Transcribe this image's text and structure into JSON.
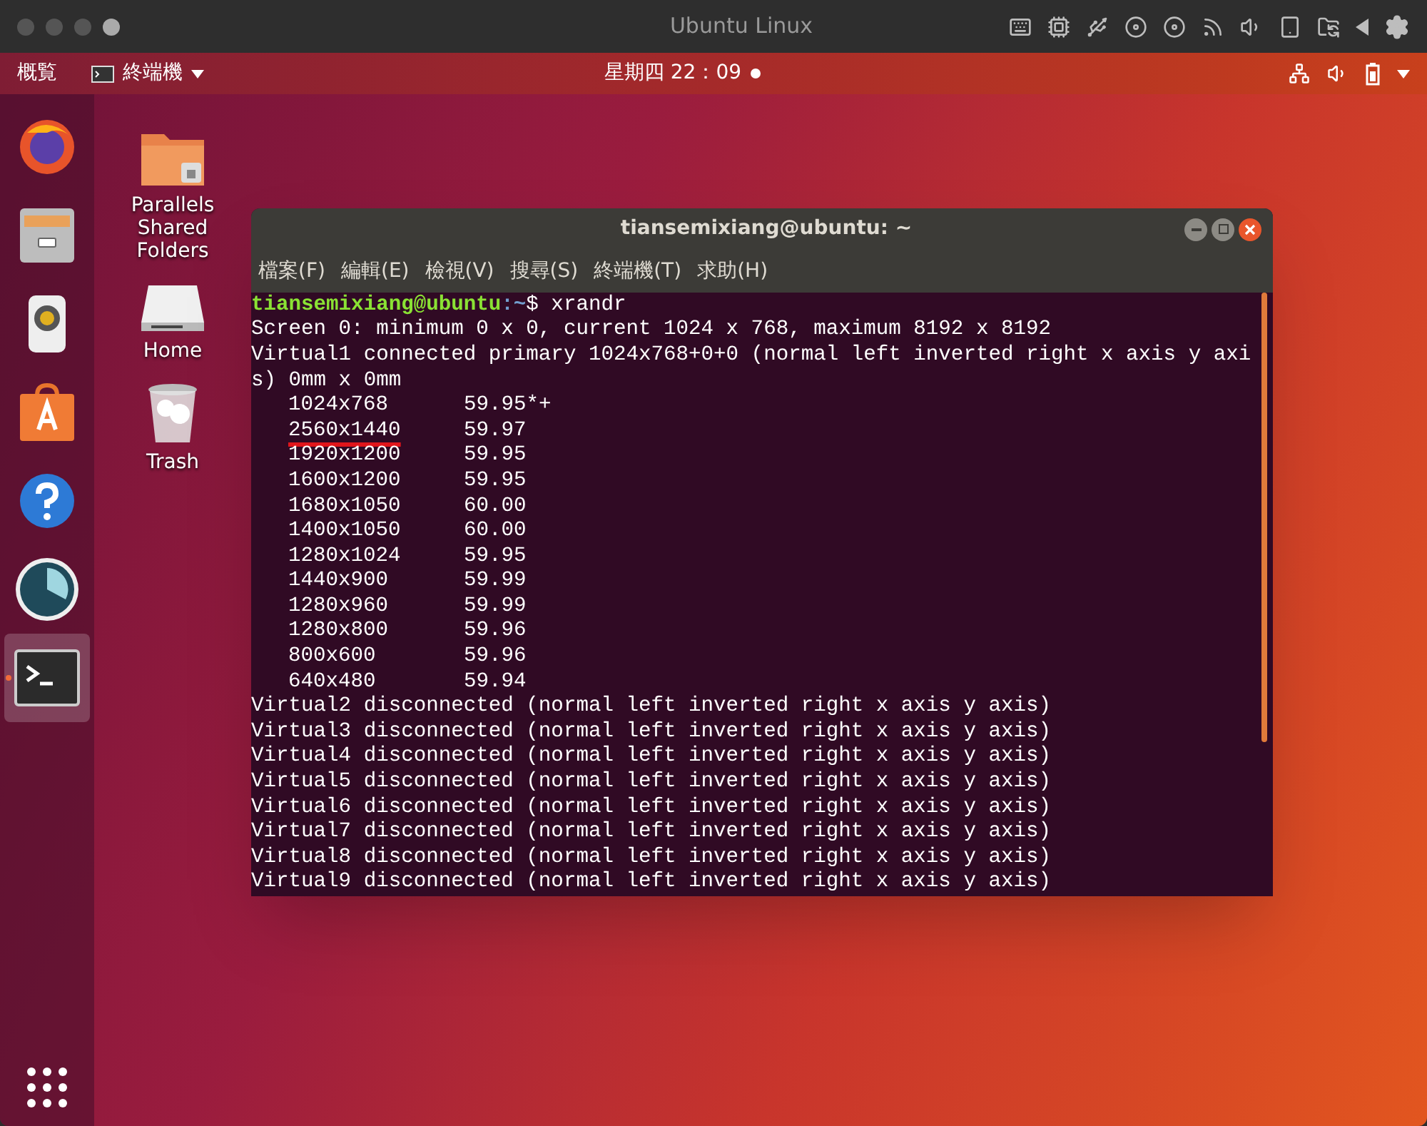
{
  "host_window": {
    "title": "Ubuntu Linux"
  },
  "top_bar": {
    "activities": "概覧",
    "app_menu": "終端機",
    "clock": "星期四 22：09",
    "notification_dot": true
  },
  "dock": [
    {
      "kind": "browser",
      "running": false
    },
    {
      "kind": "files",
      "running": false
    },
    {
      "kind": "music",
      "running": false
    },
    {
      "kind": "store",
      "running": false
    },
    {
      "kind": "help",
      "running": false
    },
    {
      "kind": "gauge",
      "running": false
    },
    {
      "kind": "terminal",
      "running": true
    }
  ],
  "desktop_icons": [
    {
      "kind": "folder",
      "label": "Parallels Shared Folders"
    },
    {
      "kind": "drive",
      "label": "Home"
    },
    {
      "kind": "trash",
      "label": "Trash"
    }
  ],
  "terminal": {
    "title": "tiansemixiang@ubuntu: ~",
    "menu": [
      "檔案(F)",
      "編輯(E)",
      "檢視(V)",
      "搜尋(S)",
      "終端機(T)",
      "求助(H)"
    ],
    "lines": [
      {
        "kind": "prompt",
        "user": "tiansemixiang@ubuntu",
        "path": ":~",
        "command": "$ xrandr"
      },
      {
        "kind": "output",
        "text": "Screen 0: minimum 0 x 0, current 1024 x 768, maximum 8192 x 8192"
      },
      {
        "kind": "output",
        "text": "Virtual1 connected primary 1024x768+0+0 (normal left inverted right x axis y axi"
      },
      {
        "kind": "output",
        "text": "s) 0mm x 0mm"
      },
      {
        "kind": "mode",
        "resolution": "1024x768",
        "rate": "59.95*+",
        "underlined": false
      },
      {
        "kind": "mode",
        "resolution": "2560x1440",
        "rate": "59.97",
        "underlined": true
      },
      {
        "kind": "mode",
        "resolution": "1920x1200",
        "rate": "59.95",
        "underlined": false
      },
      {
        "kind": "mode",
        "resolution": "1600x1200",
        "rate": "59.95",
        "underlined": false
      },
      {
        "kind": "mode",
        "resolution": "1680x1050",
        "rate": "60.00",
        "underlined": false
      },
      {
        "kind": "mode",
        "resolution": "1400x1050",
        "rate": "60.00",
        "underlined": false
      },
      {
        "kind": "mode",
        "resolution": "1280x1024",
        "rate": "59.95",
        "underlined": false
      },
      {
        "kind": "mode",
        "resolution": "1440x900",
        "rate": "59.99",
        "underlined": false
      },
      {
        "kind": "mode",
        "resolution": "1280x960",
        "rate": "59.99",
        "underlined": false
      },
      {
        "kind": "mode",
        "resolution": "1280x800",
        "rate": "59.96",
        "underlined": false
      },
      {
        "kind": "mode",
        "resolution": "800x600",
        "rate": "59.96",
        "underlined": false
      },
      {
        "kind": "mode",
        "resolution": "640x480",
        "rate": "59.94",
        "underlined": false
      },
      {
        "kind": "output",
        "text": "Virtual2 disconnected (normal left inverted right x axis y axis)"
      },
      {
        "kind": "output",
        "text": "Virtual3 disconnected (normal left inverted right x axis y axis)"
      },
      {
        "kind": "output",
        "text": "Virtual4 disconnected (normal left inverted right x axis y axis)"
      },
      {
        "kind": "output",
        "text": "Virtual5 disconnected (normal left inverted right x axis y axis)"
      },
      {
        "kind": "output",
        "text": "Virtual6 disconnected (normal left inverted right x axis y axis)"
      },
      {
        "kind": "output",
        "text": "Virtual7 disconnected (normal left inverted right x axis y axis)"
      },
      {
        "kind": "output",
        "text": "Virtual8 disconnected (normal left inverted right x axis y axis)"
      },
      {
        "kind": "output",
        "text": "Virtual9 disconnected (normal left inverted right x axis y axis)"
      }
    ]
  }
}
